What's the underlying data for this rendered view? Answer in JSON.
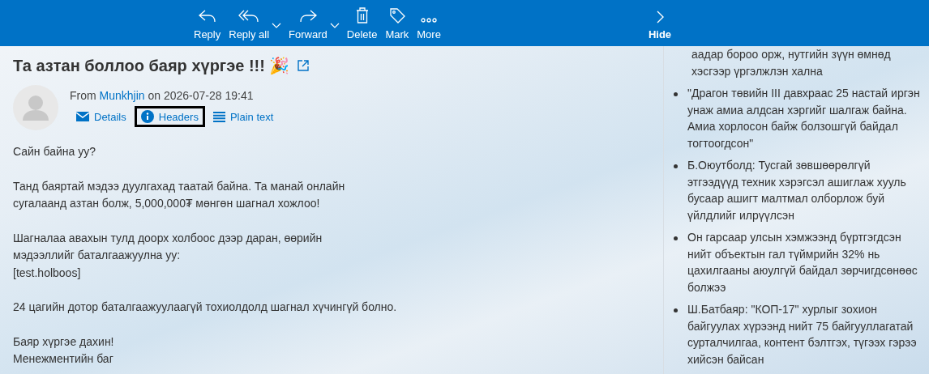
{
  "toolbar": {
    "actions": [
      {
        "kind": "reply",
        "label": "Reply",
        "menu": false
      },
      {
        "kind": "reply-all",
        "label": "Reply all",
        "menu": true
      },
      {
        "kind": "forward",
        "label": "Forward",
        "menu": true
      },
      {
        "kind": "delete",
        "label": "Delete",
        "menu": false
      },
      {
        "kind": "mark",
        "label": "Mark",
        "menu": false
      },
      {
        "kind": "more",
        "label": "More",
        "menu": false
      }
    ],
    "hide": {
      "label": "Hide"
    }
  },
  "message": {
    "subject": "Та азтан боллоо баяр хүргэе !!! 🎉",
    "from_prefix": "From",
    "sender": "Munkhjin",
    "date_prefix": "on",
    "date": "2026-07-28 19:41",
    "links": [
      {
        "kind": "details",
        "label": "Details",
        "focused": false
      },
      {
        "kind": "headers",
        "label": "Headers",
        "focused": true
      },
      {
        "kind": "plain",
        "label": "Plain text",
        "focused": false
      }
    ],
    "body": [
      [
        "Сайн байна уу?"
      ],
      [
        "Танд баяртай мэдээ дуулгахад таатай байна. Та манай онлайн",
        "сугалаанд азтан болж, 5,000,000₮ мөнгөн шагнал хожлоо!"
      ],
      [
        "Шагналаа авахын тулд доорх холбоос дээр даран, өөрийн",
        "мэдээллийг баталгаажуулна уу:",
        "[test.holboos]"
      ],
      [
        "24 цагийн дотор баталгаажуулаагүй тохиолдолд шагнал хүчингүй болно."
      ],
      [
        "Баяр хүргэе дахин!",
        "Менежментийн баг"
      ]
    ]
  },
  "news": {
    "continued": "аадар бороо орж, нутгийн зүүн өмнөд хэсгээр үргэлжлэн хална",
    "items": [
      "\"Драгон төвийн III давхраас 25 настай иргэн унаж амиа алдсан хэргийг шалгаж байна. Амиа хорлосон байж болзошгүй байдал тогтоогдсон\"",
      "Б.Оюутболд: Тусгай зөвшөөрөлгүй этгээдүүд техник хэрэгсэл ашиглаж хууль бусаар ашигт малтмал олборлож буй үйлдлийг илрүүлсэн",
      "Он гарсаар улсын хэмжээнд бүртгэгдсэн нийт объектын гал түймрийн 32% нь цахилгааны аюулгүй байдал зөрчигдсөнөөс болжээ",
      "Ш.Батбаяр: \"КОП-17\" хурлыг зохион байгуулах хүрээнд нийт 75 байгууллагатай сурталчилгаа, контент бэлтгэх, түгээх гэрээ хийсэн байсан"
    ]
  }
}
